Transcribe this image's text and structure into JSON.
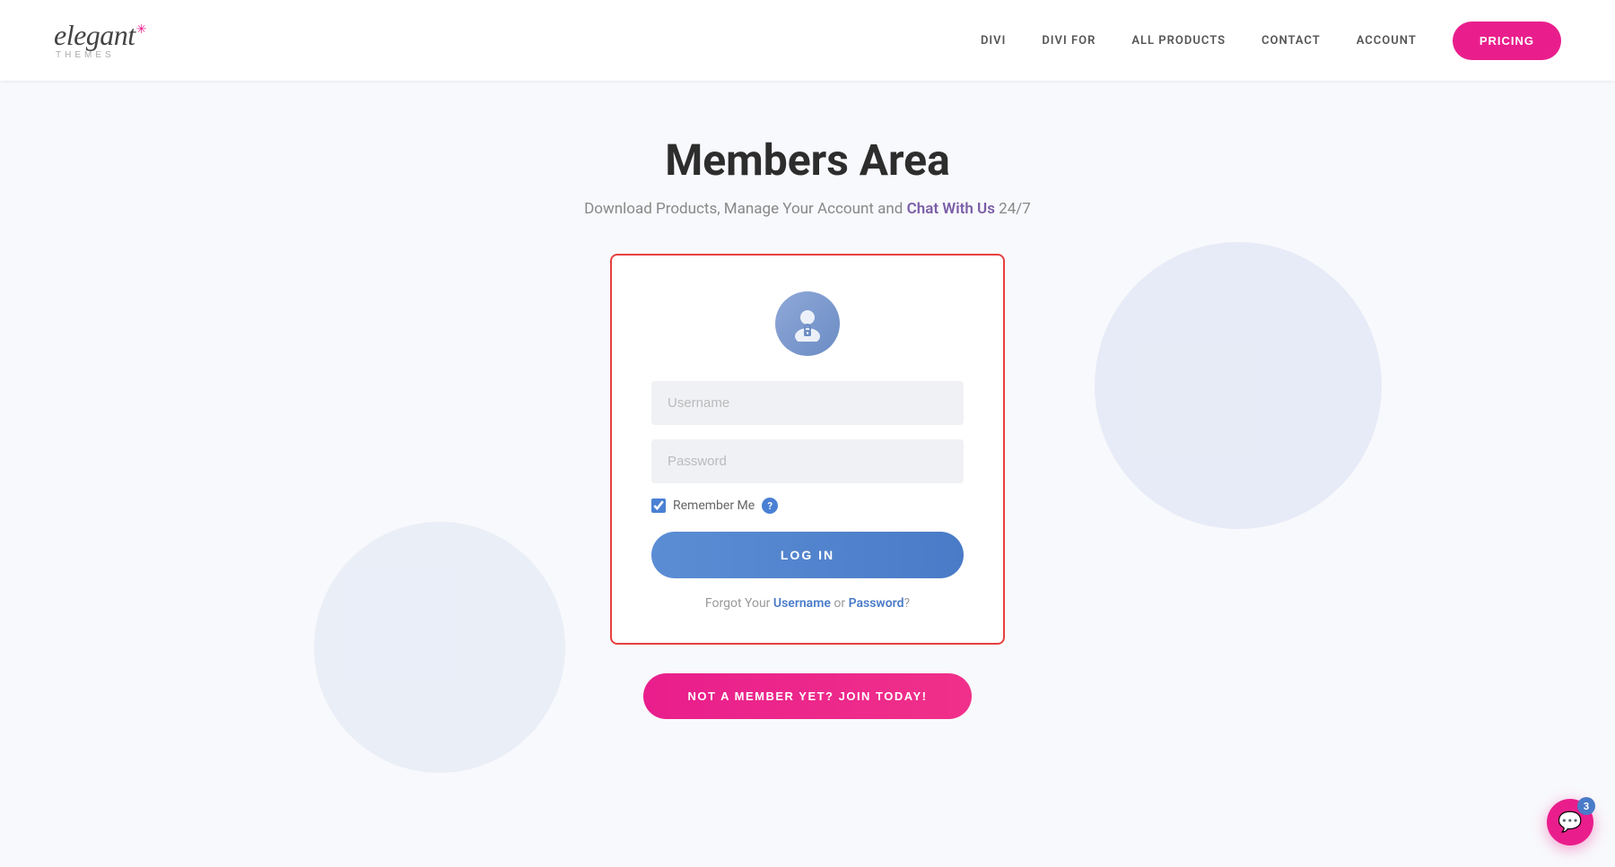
{
  "header": {
    "logo": {
      "elegant": "elegant",
      "star": "✳",
      "themes": "themes"
    },
    "nav": {
      "items": [
        {
          "id": "divi",
          "label": "DIVI"
        },
        {
          "id": "divi-for",
          "label": "DIVI FOR"
        },
        {
          "id": "all-products",
          "label": "ALL PRODUCTS"
        },
        {
          "id": "contact",
          "label": "CONTACT"
        },
        {
          "id": "account",
          "label": "ACCOUNT"
        }
      ],
      "pricing_label": "PRICING"
    }
  },
  "main": {
    "title": "Members Area",
    "subtitle_before": "Download Products, Manage Your Account and ",
    "subtitle_link": "Chat With Us",
    "subtitle_after": " 24/7"
  },
  "login_form": {
    "username_placeholder": "Username",
    "password_placeholder": "Password",
    "remember_label": "Remember Me",
    "login_button": "LOG IN",
    "forgot_prefix": "Forgot Your ",
    "forgot_username": "Username",
    "forgot_or": " or ",
    "forgot_password": "Password",
    "forgot_suffix": "?"
  },
  "join_button": {
    "label": "NOT A MEMBER YET? JOIN TODAY!"
  },
  "chat": {
    "badge_count": "3"
  }
}
